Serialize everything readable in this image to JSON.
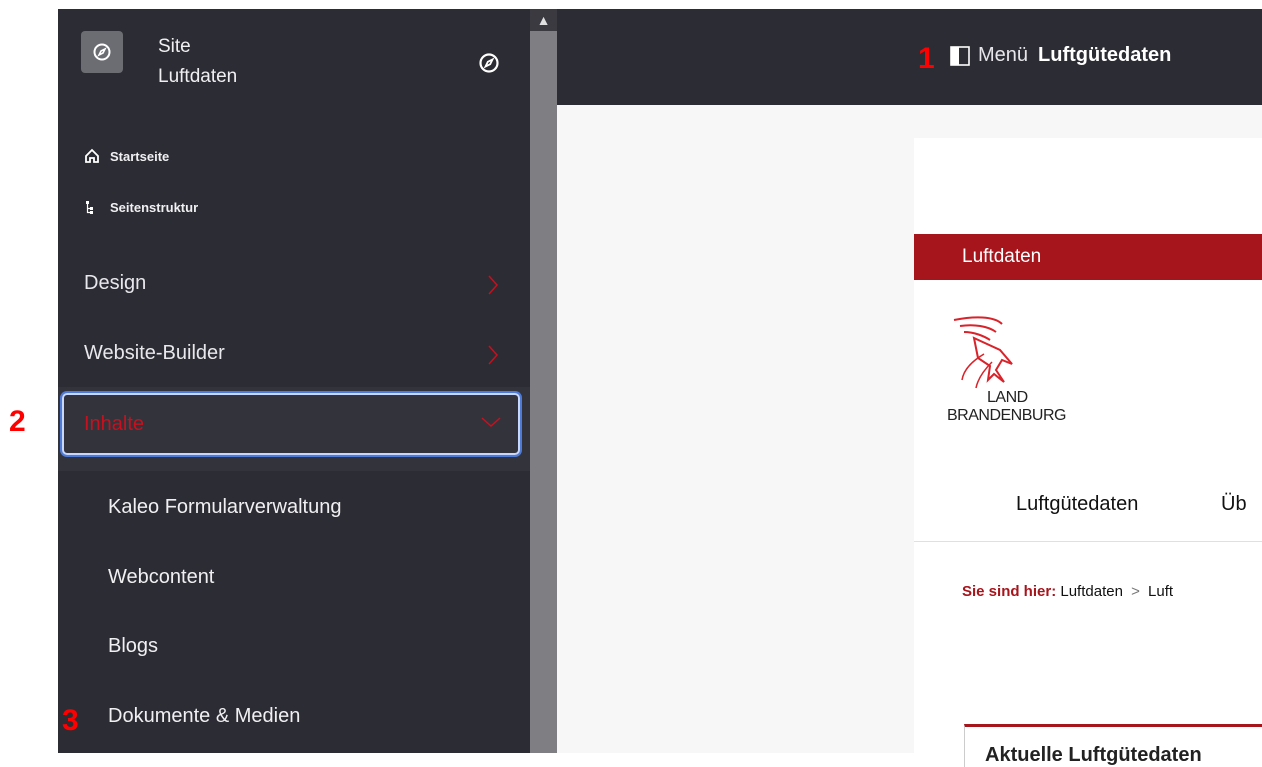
{
  "sidebar": {
    "site_label": "Site",
    "site_name": "Luftdaten",
    "home_label": "Startseite",
    "structure_label": "Seitenstruktur",
    "items": [
      {
        "label": "Design"
      },
      {
        "label": "Website-Builder"
      },
      {
        "label": "Inhalte"
      }
    ],
    "sub_items": [
      {
        "label": "Kaleo Formularverwaltung"
      },
      {
        "label": "Webcontent"
      },
      {
        "label": "Blogs"
      },
      {
        "label": "Dokumente & Medien"
      }
    ]
  },
  "topbar": {
    "menu_label": "Menü",
    "page_title": "Luftgütedaten"
  },
  "markers": [
    "1",
    "2",
    "3"
  ],
  "page": {
    "banner": "Luftdaten",
    "logo_line1": "LAND",
    "logo_line2": "BRANDENBURG",
    "nav_items": [
      "Luftgütedaten",
      "Üb"
    ],
    "breadcrumb_prefix": "Sie sind hier:",
    "breadcrumb_items": [
      "Luftdaten",
      "Luft"
    ],
    "news_title": "Aktuelle Luftgütedaten"
  },
  "colors": {
    "sidebar_bg": "#2c2c34",
    "accent_red": "#c8101e",
    "banner_red": "#a6141c",
    "focus_blue": "#4e7bd8"
  }
}
